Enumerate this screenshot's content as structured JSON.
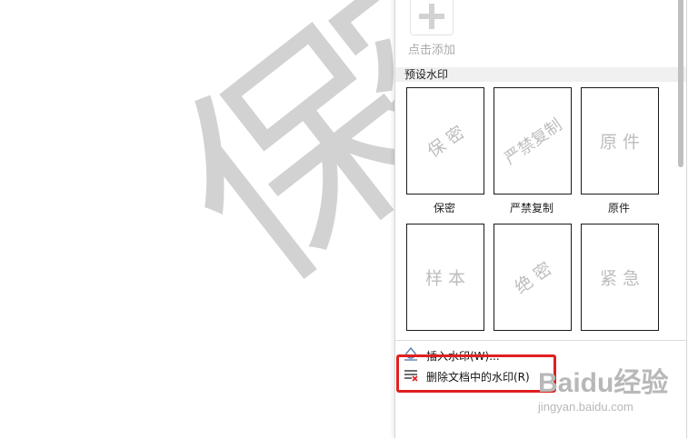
{
  "document": {
    "watermark_text": "保密"
  },
  "panel": {
    "add_label": "点击添加",
    "section_title": "预设水印",
    "presets": [
      {
        "preview_text": "保 密",
        "label": "保密"
      },
      {
        "preview_text": "严禁复制",
        "label": "严禁复制"
      },
      {
        "preview_text": "原 件",
        "label": "原件"
      },
      {
        "preview_text": "样 本",
        "label": "样本"
      },
      {
        "preview_text": "绝 密",
        "label": "绝密"
      },
      {
        "preview_text": "紧 急",
        "label": "紧急"
      }
    ],
    "menu": {
      "insert_label": "插入水印(W)...",
      "delete_label": "删除文档中的水印(R)"
    }
  },
  "brand": {
    "logo_text": "Baidu经验",
    "url_text": "jingyan.baidu.com"
  },
  "colors": {
    "highlight": "#e02020",
    "watermark": "#d2d2d2"
  }
}
